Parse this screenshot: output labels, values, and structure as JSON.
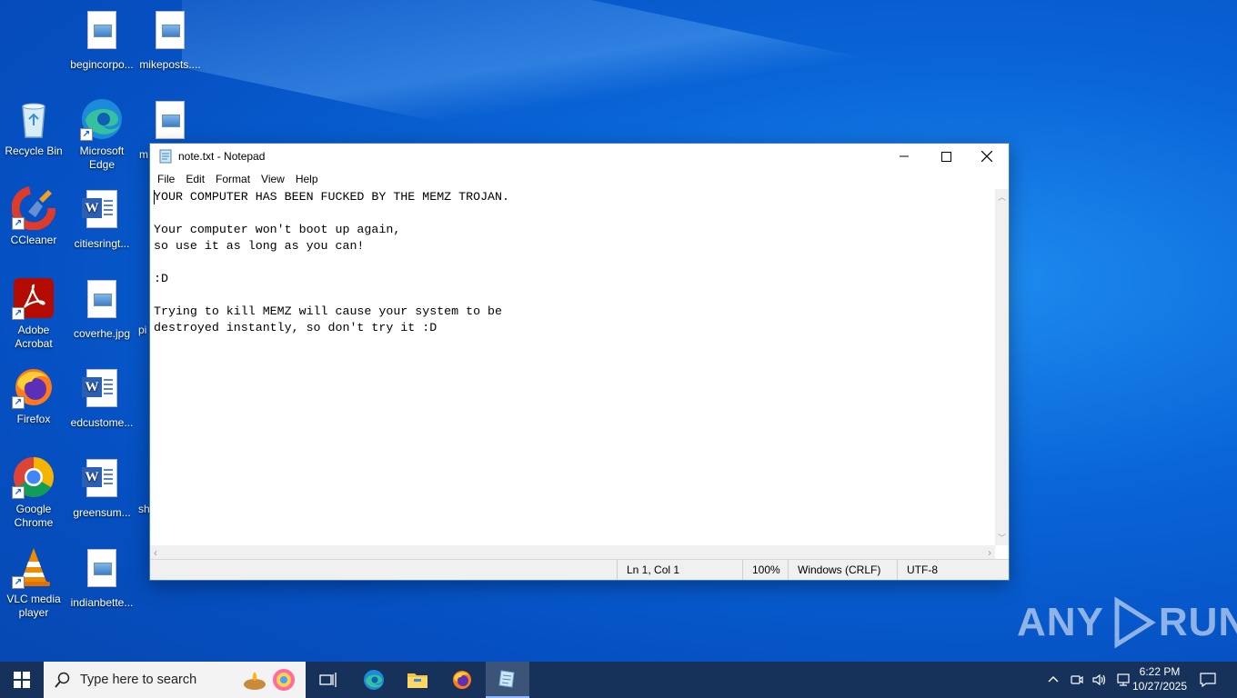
{
  "desktop": {
    "icons": [
      {
        "label": "begincorpo..."
      },
      {
        "label": "mikeposts...."
      },
      {
        "label": "Recycle Bin"
      },
      {
        "label": "Microsoft Edge"
      },
      {
        "label": "m"
      },
      {
        "label": "CCleaner"
      },
      {
        "label": "citiesringt..."
      },
      {
        "label": "Adobe Acrobat"
      },
      {
        "label": "coverhe.jpg"
      },
      {
        "label": "pi"
      },
      {
        "label": "Firefox"
      },
      {
        "label": "edcustome..."
      },
      {
        "label": "Google Chrome"
      },
      {
        "label": "greensum..."
      },
      {
        "label": "sh"
      },
      {
        "label": "VLC media player"
      },
      {
        "label": "indianbette..."
      }
    ]
  },
  "notepad": {
    "title": "note.txt - Notepad",
    "menu": [
      "File",
      "Edit",
      "Format",
      "View",
      "Help"
    ],
    "content": "YOUR COMPUTER HAS BEEN FUCKED BY THE MEMZ TROJAN.\n\nYour computer won't boot up again,\nso use it as long as you can!\n\n:D\n\nTrying to kill MEMZ will cause your system to be\ndestroyed instantly, so don't try it :D",
    "status": {
      "position": "Ln 1, Col 1",
      "zoom": "100%",
      "line_ending": "Windows (CRLF)",
      "encoding": "UTF-8"
    }
  },
  "taskbar": {
    "search_placeholder": "Type here to search",
    "time": "6:22 PM",
    "date": "10/27/2025"
  },
  "watermark": {
    "text_left": "ANY",
    "text_right": "RUN"
  },
  "colors": {
    "desktop": "#0a66d8",
    "taskbar": "#16315a",
    "accent": "#3c78c8"
  }
}
